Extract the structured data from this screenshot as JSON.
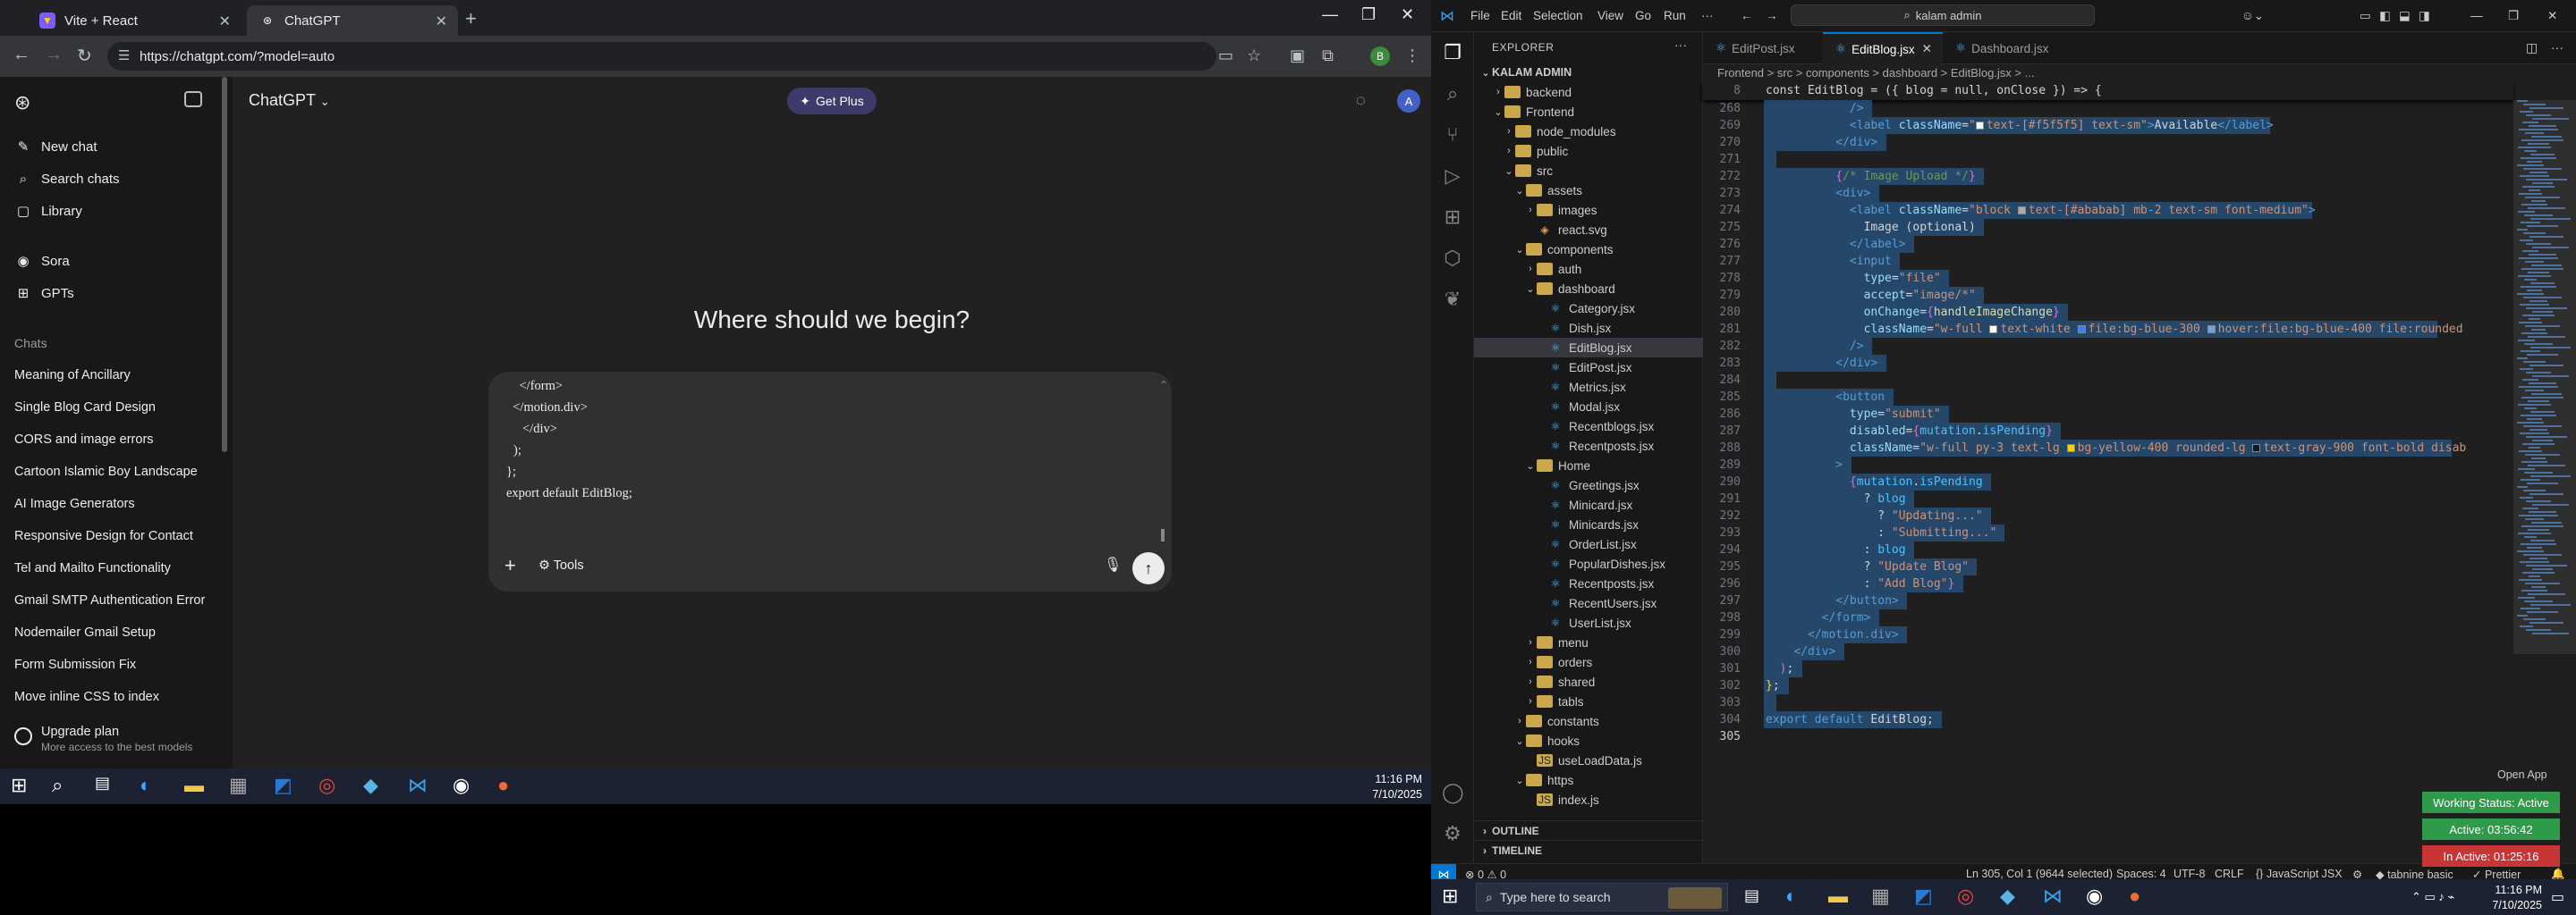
{
  "chrome": {
    "tabs": [
      {
        "title": "Vite + React",
        "active": false
      },
      {
        "title": "ChatGPT",
        "active": true
      }
    ],
    "url": "https://chatgpt.com/?model=auto"
  },
  "chatgpt": {
    "sidebar": {
      "top_items": [
        {
          "label": "New chat",
          "icon": "edit-icon"
        },
        {
          "label": "Search chats",
          "icon": "search-icon"
        },
        {
          "label": "Library",
          "icon": "library-icon"
        },
        {
          "label": "Sora",
          "icon": "sora-icon"
        },
        {
          "label": "GPTs",
          "icon": "gpts-icon"
        }
      ],
      "chats_heading": "Chats",
      "chats": [
        "Meaning of Ancillary",
        "Single Blog Card Design",
        "CORS and image errors",
        "Cartoon Islamic Boy Landscape",
        "AI Image Generators",
        "Responsive Design for Contact",
        "Tel and Mailto Functionality",
        "Gmail SMTP Authentication Error",
        "Nodemailer Gmail Setup",
        "Form Submission Fix",
        "Move inline CSS to index"
      ],
      "upgrade_title": "Upgrade plan",
      "upgrade_sub": "More access to the best models"
    },
    "model": "ChatGPT",
    "get_plus": "Get Plus",
    "avatar_letter": "A",
    "headline": "Where should we begin?",
    "composer_lines": [
      "    </form>",
      "  </motion.div>",
      "</div>",
      ");",
      "};",
      "export default EditBlog;"
    ],
    "tools_label": "Tools"
  },
  "taskbar_left": {
    "time": "11:16 PM",
    "date": "7/10/2025"
  },
  "vscode": {
    "menu": [
      "File",
      "Edit",
      "Selection",
      "View",
      "Go",
      "Run",
      "···"
    ],
    "search": "kalam admin",
    "explorer_title": "EXPLORER",
    "root": "KALAM ADMIN",
    "tree": [
      {
        "label": "backend",
        "type": "folder",
        "depth": 1,
        "open": false
      },
      {
        "label": "Frontend",
        "type": "folder",
        "depth": 1,
        "open": true
      },
      {
        "label": "node_modules",
        "type": "folder",
        "depth": 2,
        "open": false
      },
      {
        "label": "public",
        "type": "folder",
        "depth": 2,
        "open": false
      },
      {
        "label": "src",
        "type": "folder",
        "depth": 2,
        "open": true
      },
      {
        "label": "assets",
        "type": "folder",
        "depth": 3,
        "open": true
      },
      {
        "label": "images",
        "type": "folder",
        "depth": 4,
        "open": false
      },
      {
        "label": "react.svg",
        "type": "svg",
        "depth": 4
      },
      {
        "label": "components",
        "type": "folder",
        "depth": 3,
        "open": true
      },
      {
        "label": "auth",
        "type": "folder",
        "depth": 4,
        "open": false
      },
      {
        "label": "dashboard",
        "type": "folder",
        "depth": 4,
        "open": true
      },
      {
        "label": "Category.jsx",
        "type": "react",
        "depth": 5
      },
      {
        "label": "Dish.jsx",
        "type": "react",
        "depth": 5
      },
      {
        "label": "EditBlog.jsx",
        "type": "react",
        "depth": 5,
        "selected": true
      },
      {
        "label": "EditPost.jsx",
        "type": "react",
        "depth": 5
      },
      {
        "label": "Metrics.jsx",
        "type": "react",
        "depth": 5
      },
      {
        "label": "Modal.jsx",
        "type": "react",
        "depth": 5
      },
      {
        "label": "Recentblogs.jsx",
        "type": "react",
        "depth": 5
      },
      {
        "label": "Recentposts.jsx",
        "type": "react",
        "depth": 5
      },
      {
        "label": "Home",
        "type": "folder",
        "depth": 4,
        "open": true
      },
      {
        "label": "Greetings.jsx",
        "type": "react",
        "depth": 5
      },
      {
        "label": "Minicard.jsx",
        "type": "react",
        "depth": 5
      },
      {
        "label": "Minicards.jsx",
        "type": "react",
        "depth": 5
      },
      {
        "label": "OrderList.jsx",
        "type": "react",
        "depth": 5
      },
      {
        "label": "PopularDishes.jsx",
        "type": "react",
        "depth": 5
      },
      {
        "label": "Recentposts.jsx",
        "type": "react",
        "depth": 5
      },
      {
        "label": "RecentUsers.jsx",
        "type": "react",
        "depth": 5
      },
      {
        "label": "UserList.jsx",
        "type": "react",
        "depth": 5
      },
      {
        "label": "menu",
        "type": "folder",
        "depth": 4,
        "open": false
      },
      {
        "label": "orders",
        "type": "folder",
        "depth": 4,
        "open": false
      },
      {
        "label": "shared",
        "type": "folder",
        "depth": 4,
        "open": false
      },
      {
        "label": "tabls",
        "type": "folder",
        "depth": 4,
        "open": false
      },
      {
        "label": "constants",
        "type": "folder",
        "depth": 3,
        "open": false
      },
      {
        "label": "hooks",
        "type": "folder",
        "depth": 3,
        "open": true
      },
      {
        "label": "useLoadData.js",
        "type": "js",
        "depth": 4
      },
      {
        "label": "https",
        "type": "folder",
        "depth": 3,
        "open": true
      },
      {
        "label": "index.js",
        "type": "js",
        "depth": 4
      }
    ],
    "outline": "OUTLINE",
    "timeline": "TIMELINE",
    "editor_tabs": [
      {
        "title": "EditPost.jsx",
        "active": false
      },
      {
        "title": "EditBlog.jsx",
        "active": true
      },
      {
        "title": "Dashboard.jsx",
        "active": false
      }
    ],
    "breadcrumb": "Frontend > src > components > dashboard > EditBlog.jsx > ...",
    "sticky_line": {
      "num": "8",
      "text": "const EditBlog = ({ blog = null, onClose }) => {"
    },
    "code": [
      {
        "n": "268",
        "html": "            <span class='tag'>/&gt;</span>"
      },
      {
        "n": "269",
        "html": "            <span class='tag'>&lt;label</span> <span class='attr'>className</span><span class='txt'>=</span><span class='str'>\"<span class='sq' style='background:#f5f5f5'></span>text-[#f5f5f5] text-sm\"</span><span class='tag'>&gt;</span><span class='txt'>Available</span><span class='tag'>&lt;/label&gt;</span>"
      },
      {
        "n": "270",
        "html": "          <span class='tag'>&lt;/div&gt;</span>"
      },
      {
        "n": "271",
        "html": ""
      },
      {
        "n": "272",
        "html": "          <span class='bra2'>{</span><span class='cmt'>/* Image Upload */</span><span class='bra2'>}</span>"
      },
      {
        "n": "273",
        "html": "          <span class='tag'>&lt;div&gt;</span>"
      },
      {
        "n": "274",
        "html": "            <span class='tag'>&lt;label</span> <span class='attr'>className</span><span class='txt'>=</span><span class='str'>\"block <span class='sq' style='background:#ababab'></span>text-[#ababab] mb-2 text-sm font-medium\"</span><span class='tag'>&gt;</span>"
      },
      {
        "n": "275",
        "html": "              <span class='txt'>Image (optional)</span>"
      },
      {
        "n": "276",
        "html": "            <span class='tag'>&lt;/label&gt;</span>"
      },
      {
        "n": "277",
        "html": "            <span class='tag'>&lt;input</span>"
      },
      {
        "n": "278",
        "html": "              <span class='attr'>type</span><span class='txt'>=</span><span class='str'>\"file\"</span>"
      },
      {
        "n": "279",
        "html": "              <span class='attr'>accept</span><span class='txt'>=</span><span class='str'>\"image/*\"</span>"
      },
      {
        "n": "280",
        "html": "              <span class='attr'>onChange</span><span class='txt'>=</span><span class='bra2'>{</span><span class='fn'>handleImageChange</span><span class='bra2'>}</span>"
      },
      {
        "n": "281",
        "html": "              <span class='attr'>className</span><span class='txt'>=</span><span class='str'>\"w-full <span class='sq' style='background:#fff'></span>text-white <span class='sq' style='background:#3b82f6'></span>file:bg-blue-300 <span class='sq' style='background:#60a5fa'></span>hover:file:bg-blue-400 file:rounded</span>"
      },
      {
        "n": "282",
        "html": "            <span class='tag'>/&gt;</span>"
      },
      {
        "n": "283",
        "html": "          <span class='tag'>&lt;/div&gt;</span>"
      },
      {
        "n": "284",
        "html": ""
      },
      {
        "n": "285",
        "html": "          <span class='tag'>&lt;button</span>"
      },
      {
        "n": "286",
        "html": "            <span class='attr'>type</span><span class='txt'>=</span><span class='str'>\"submit\"</span>"
      },
      {
        "n": "287",
        "html": "            <span class='attr'>disabled</span><span class='txt'>=</span><span class='bra2'>{</span><span class='var'>mutation</span><span class='txt'>.</span><span class='var'>isPending</span><span class='bra2'>}</span>"
      },
      {
        "n": "288",
        "html": "            <span class='attr'>className</span><span class='txt'>=</span><span class='str'>\"w-full py-3 text-lg <span class='sq' style='background:#facc15'></span>bg-yellow-400 rounded-lg <span class='sq' style='background:#111827'></span>text-gray-900 font-bold disab</span>"
      },
      {
        "n": "289",
        "html": "          <span class='tag'>&gt;</span>"
      },
      {
        "n": "290",
        "html": "            <span class='bra2'>{</span><span class='var'>mutation</span><span class='txt'>.</span><span class='var'>isPending</span>"
      },
      {
        "n": "291",
        "html": "              <span class='txt'>? </span><span class='var'>blog</span>"
      },
      {
        "n": "292",
        "html": "                <span class='txt'>? </span><span class='str'>\"Updating...\"</span>"
      },
      {
        "n": "293",
        "html": "                <span class='txt'>: </span><span class='str'>\"Submitting...\"</span>"
      },
      {
        "n": "294",
        "html": "              <span class='txt'>: </span><span class='var'>blog</span>"
      },
      {
        "n": "295",
        "html": "              <span class='txt'>? </span><span class='str'>\"Update Blog\"</span>"
      },
      {
        "n": "296",
        "html": "              <span class='txt'>: </span><span class='str'>\"Add Blog\"</span><span class='bra2'>}</span>"
      },
      {
        "n": "297",
        "html": "          <span class='tag'>&lt;/button&gt;</span>"
      },
      {
        "n": "298",
        "html": "        <span class='tag'>&lt;/form&gt;</span>"
      },
      {
        "n": "299",
        "html": "      <span class='tag'>&lt;/motion.div&gt;</span>"
      },
      {
        "n": "300",
        "html": "    <span class='tag'>&lt;/div&gt;</span>"
      },
      {
        "n": "301",
        "html": "  <span class='bra2'>)</span><span class='txt'>;</span>"
      },
      {
        "n": "302",
        "html": "<span class='brace'>}</span><span class='txt'>;</span>"
      },
      {
        "n": "303",
        "html": ""
      },
      {
        "n": "304",
        "html": "<span class='kw'>export</span> <span class='kw'>default</span> <span class='txt'>EditBlog;</span>"
      },
      {
        "n": "305",
        "html": ""
      }
    ],
    "status": {
      "errors": "0",
      "warnings": "0",
      "position": "Ln 305, Col 1 (9644 selected)",
      "spaces": "Spaces: 4",
      "encoding": "UTF-8",
      "eol": "CRLF",
      "language": "JavaScript JSX",
      "tabnine": "tabnine basic",
      "prettier": "Prettier"
    },
    "open_app": "Open App",
    "working_status": "Working Status: Active",
    "active_time": "Active: 03:56:42",
    "inactive_time": "In Active: 01:25:16",
    "colors": {
      "active": "#2e9a4a",
      "inactive": "#c83535",
      "accent": "#0078d4"
    }
  },
  "taskbar_right": {
    "search_placeholder": "Type here to search",
    "time": "11:16 PM",
    "date": "7/10/2025"
  }
}
